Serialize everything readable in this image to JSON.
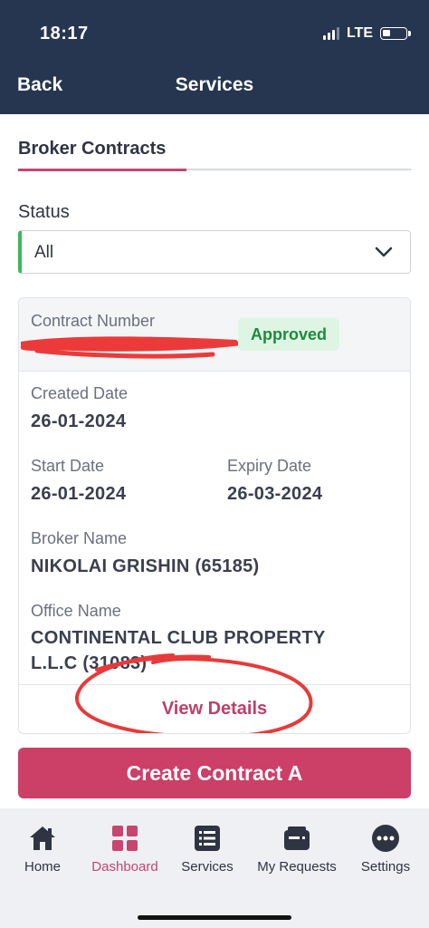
{
  "status_bar": {
    "time": "18:17",
    "network": "LTE"
  },
  "header": {
    "back_label": "Back",
    "title": "Services"
  },
  "tabs": [
    {
      "label": "Broker Contracts",
      "active": true
    }
  ],
  "filter": {
    "label": "Status",
    "value": "All"
  },
  "contract": {
    "number_label": "Contract Number",
    "status": "Approved",
    "created_label": "Created Date",
    "created_value": "26-01-2024",
    "start_label": "Start Date",
    "start_value": "26-01-2024",
    "expiry_label": "Expiry Date",
    "expiry_value": "26-03-2024",
    "broker_label": "Broker Name",
    "broker_value": "NIKOLAI GRISHIN (65185)",
    "office_label": "Office Name",
    "office_value_line1": "CONTINENTAL CLUB PROPERTY",
    "office_value_line2": "L.L.C (31083)",
    "view_details": "View Details"
  },
  "create_button": "Create Contract A",
  "bottom_nav": [
    {
      "label": "Home",
      "icon": "home-icon"
    },
    {
      "label": "Dashboard",
      "icon": "dashboard-grid-icon",
      "active": true
    },
    {
      "label": "Services",
      "icon": "list-icon"
    },
    {
      "label": "My Requests",
      "icon": "wallet-icon"
    },
    {
      "label": "Settings",
      "icon": "more-dots-icon"
    }
  ],
  "colors": {
    "header_bg": "#263650",
    "accent": "#cc3f67",
    "approved_bg": "#def5e4",
    "approved_text": "#1f8a3e",
    "select_border": "#3cb85c"
  }
}
